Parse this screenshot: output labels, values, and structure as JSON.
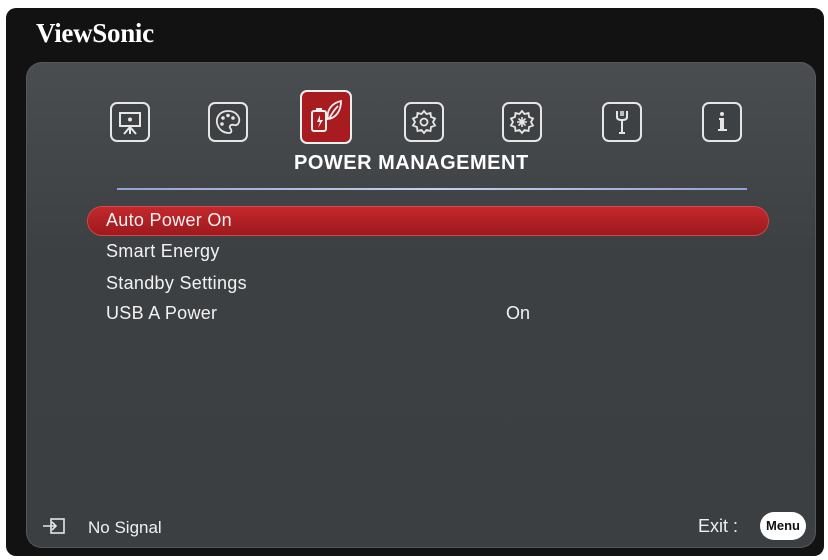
{
  "brand": "ViewSonic",
  "tabs": [
    {
      "icon": "display-icon",
      "active": false
    },
    {
      "icon": "color-palette-icon",
      "active": false
    },
    {
      "icon": "power-management-icon",
      "active": true
    },
    {
      "icon": "basic-settings-icon",
      "active": false
    },
    {
      "icon": "advanced-settings-icon",
      "active": false
    },
    {
      "icon": "maintenance-wrench-icon",
      "active": false
    },
    {
      "icon": "information-icon",
      "active": false
    }
  ],
  "section_title": "POWER MANAGEMENT",
  "menu": {
    "items": [
      {
        "label": "Auto Power On",
        "value": "",
        "selected": true
      },
      {
        "label": "Smart Energy",
        "value": "",
        "selected": false
      },
      {
        "label": "Standby Settings",
        "value": "",
        "selected": false
      },
      {
        "label": "USB A Power",
        "value": "On",
        "selected": false
      }
    ]
  },
  "footer": {
    "signal": "No Signal",
    "exit_label": "Exit :",
    "menu_button": "Menu"
  },
  "colors": {
    "accent": "#a81c20",
    "panel": "#3e4144",
    "frame": "#121212"
  }
}
